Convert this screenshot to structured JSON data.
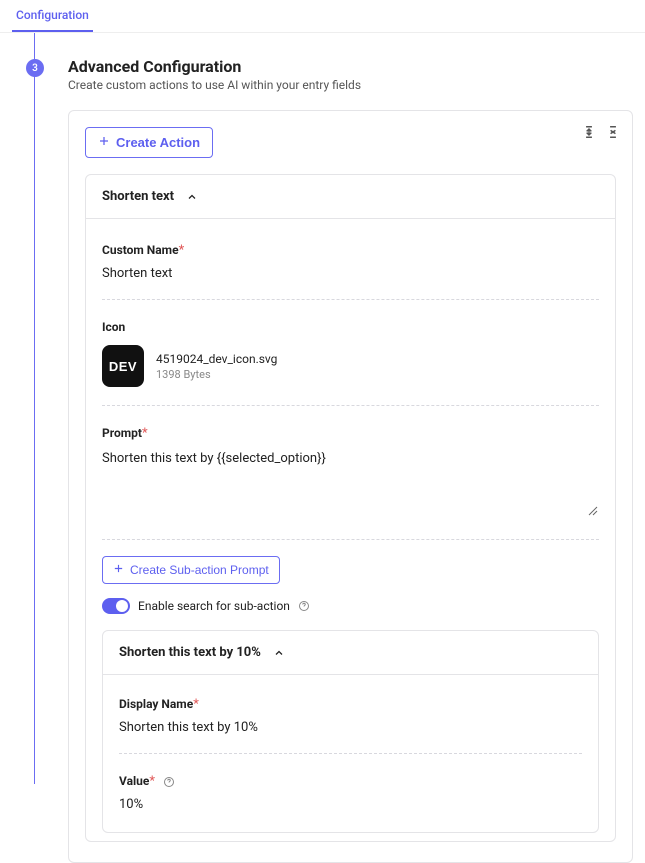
{
  "tab": {
    "label": "Configuration"
  },
  "step": {
    "number": "3"
  },
  "section": {
    "title": "Advanced Configuration",
    "subtitle": "Create custom actions to use AI within your entry fields"
  },
  "createActionLabel": "Create Action",
  "action": {
    "header": "Shorten text",
    "customName": {
      "label": "Custom Name",
      "value": "Shorten text"
    },
    "icon": {
      "label": "Icon",
      "filename": "4519024_dev_icon.svg",
      "filesize": "1398 Bytes",
      "glyph": "DEV"
    },
    "prompt": {
      "label": "Prompt",
      "value": "Shorten this text by {{selected_option}}"
    },
    "createSubLabel": "Create Sub-action Prompt",
    "enableSearchLabel": "Enable search for sub-action"
  },
  "subaction": {
    "header": "Shorten this text by 10%",
    "displayName": {
      "label": "Display Name",
      "value": "Shorten this text by 10%"
    },
    "value": {
      "label": "Value",
      "value": "10%"
    }
  }
}
